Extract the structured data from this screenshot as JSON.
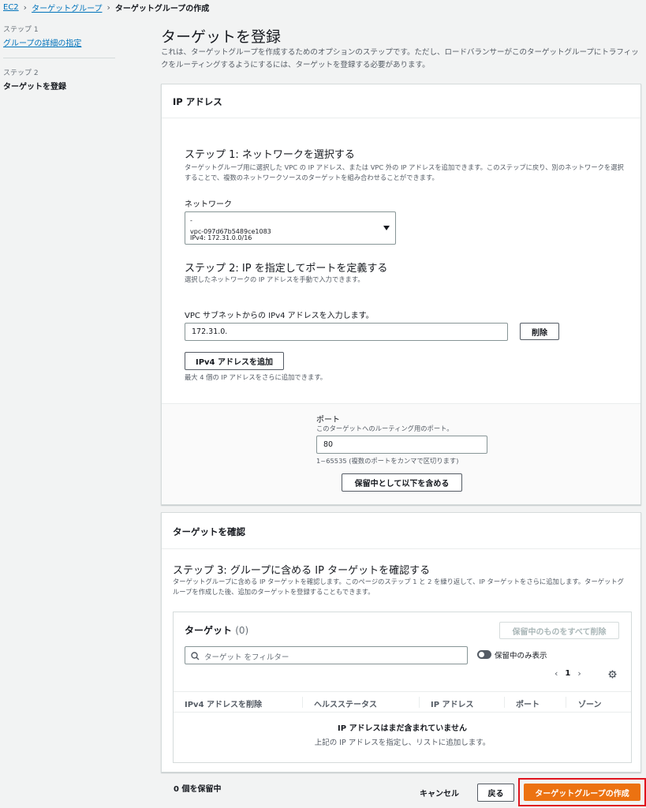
{
  "breadcrumb": {
    "items": [
      "EC2",
      "ターゲットグループ"
    ],
    "current": "ターゲットグループの作成"
  },
  "sidenav": {
    "step1_num": "ステップ 1",
    "step1_label": "グループの詳細の指定",
    "step2_num": "ステップ 2",
    "step2_label": "ターゲットを登録"
  },
  "page": {
    "title": "ターゲットを登録",
    "description": "これは、ターゲットグループを作成するためのオプションのステップです。ただし、ロードバランサーがこのターゲットグループにトラフィックをルーティングするようにするには、ターゲットを登録する必要があります。"
  },
  "ip_panel": {
    "header": "IP アドレス",
    "step1_title": "ステップ 1: ネットワークを選択する",
    "step1_desc": "ターゲットグループ用に選択した VPC の IP アドレス、または VPC 外の IP アドレスを追加できます。このステップに戻り、別のネットワークを選択することで、複数のネットワークソースのターゲットを組み合わせることができます。",
    "network_label": "ネットワーク",
    "network_select": {
      "line1": "-",
      "line2": "vpc-097d67b5489ce1083",
      "line3": "IPv4: 172.31.0.0/16"
    },
    "step2_title": "ステップ 2: IP を指定してポートを定義する",
    "step2_desc": "選択したネットワークの IP アドレスを手動で入力できます。",
    "ipv4_label": "VPC サブネットからの IPv4 アドレスを入力します。",
    "ipv4_value": "172.31.0.",
    "remove_button": "削除",
    "add_ipv4_button": "IPv4 アドレスを追加",
    "add_hint": "最大 4 個の IP アドレスをさらに追加できます。",
    "port_label": "ポート",
    "port_desc": "このターゲットへのルーティング用のポート。",
    "port_value": "80",
    "port_hint": "1~65535 (複数のポートをカンマで区切ります)",
    "include_pending_button": "保留中として以下を含める"
  },
  "review_panel": {
    "header": "ターゲットを確認",
    "step3_title": "ステップ 3: グループに含める IP ターゲットを確認する",
    "step3_desc": "ターゲットグループに含める IP ターゲットを確認します。このページのステップ 1 と 2 を繰り返して、IP ターゲットをさらに追加します。ターゲットグループを作成した後、追加のターゲットを登録することもできます。",
    "targets_title": "ターゲット",
    "targets_count": "(0)",
    "remove_all_pending_button": "保留中のものをすべて削除",
    "filter_placeholder": "ターゲット をフィルター",
    "pending_only_label": "保留中のみ表示",
    "page_number": "1",
    "columns": [
      "IPv4 アドレスを削除",
      "ヘルスステータス",
      "IP アドレス",
      "ポート",
      "ゾーン"
    ],
    "empty_title": "IP アドレスはまだ含まれていません",
    "empty_desc": "上記の IP アドレスを指定し、リストに追加します。"
  },
  "footer": {
    "pending_count": "0 個を保留中",
    "cancel": "キャンセル",
    "back": "戻る",
    "create": "ターゲットグループの作成"
  },
  "colors": {
    "primary": "#ec7211",
    "link": "#0073bb",
    "highlight": "#e0141e"
  }
}
